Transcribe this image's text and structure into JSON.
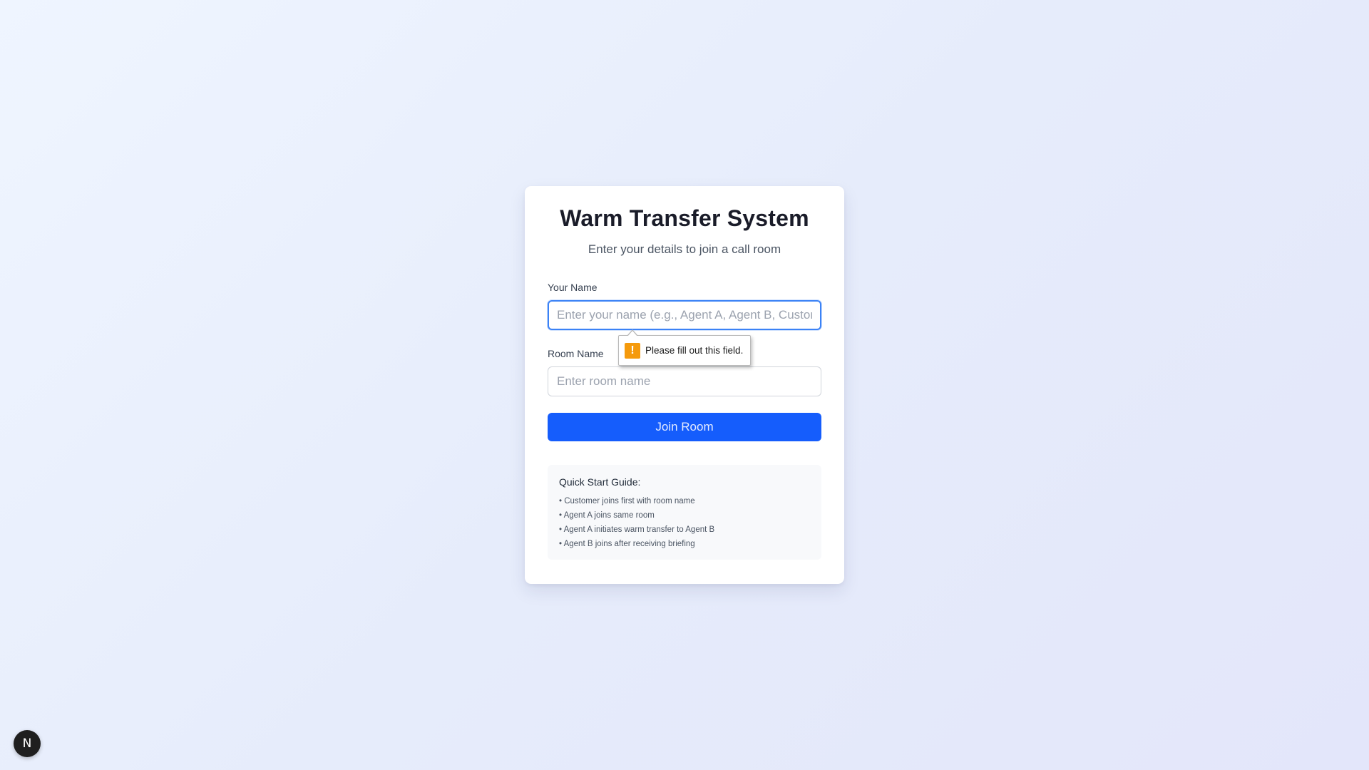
{
  "page": {
    "title": "Warm Transfer System",
    "subtitle": "Enter your details to join a call room"
  },
  "form": {
    "name_label": "Your Name",
    "name_value": "",
    "name_placeholder": "Enter your name (e.g., Agent A, Agent B, Customer)",
    "room_label": "Room Name",
    "room_value": "",
    "room_placeholder": "Enter room name",
    "submit_label": "Join Room"
  },
  "validation": {
    "message": "Please fill out this field.",
    "icon": "warning-icon"
  },
  "guide": {
    "title": "Quick Start Guide:",
    "items": [
      "• Customer joins first with room name",
      "• Agent A joins same room",
      "• Agent A initiates warm transfer to Agent B",
      "• Agent B joins after receiving briefing"
    ]
  },
  "badge": {
    "letter": "N",
    "icon": "nextjs-logo-icon"
  },
  "colors": {
    "primary": "#155dfc",
    "focus_border": "#3b82f6",
    "warning": "#f59a0c"
  }
}
